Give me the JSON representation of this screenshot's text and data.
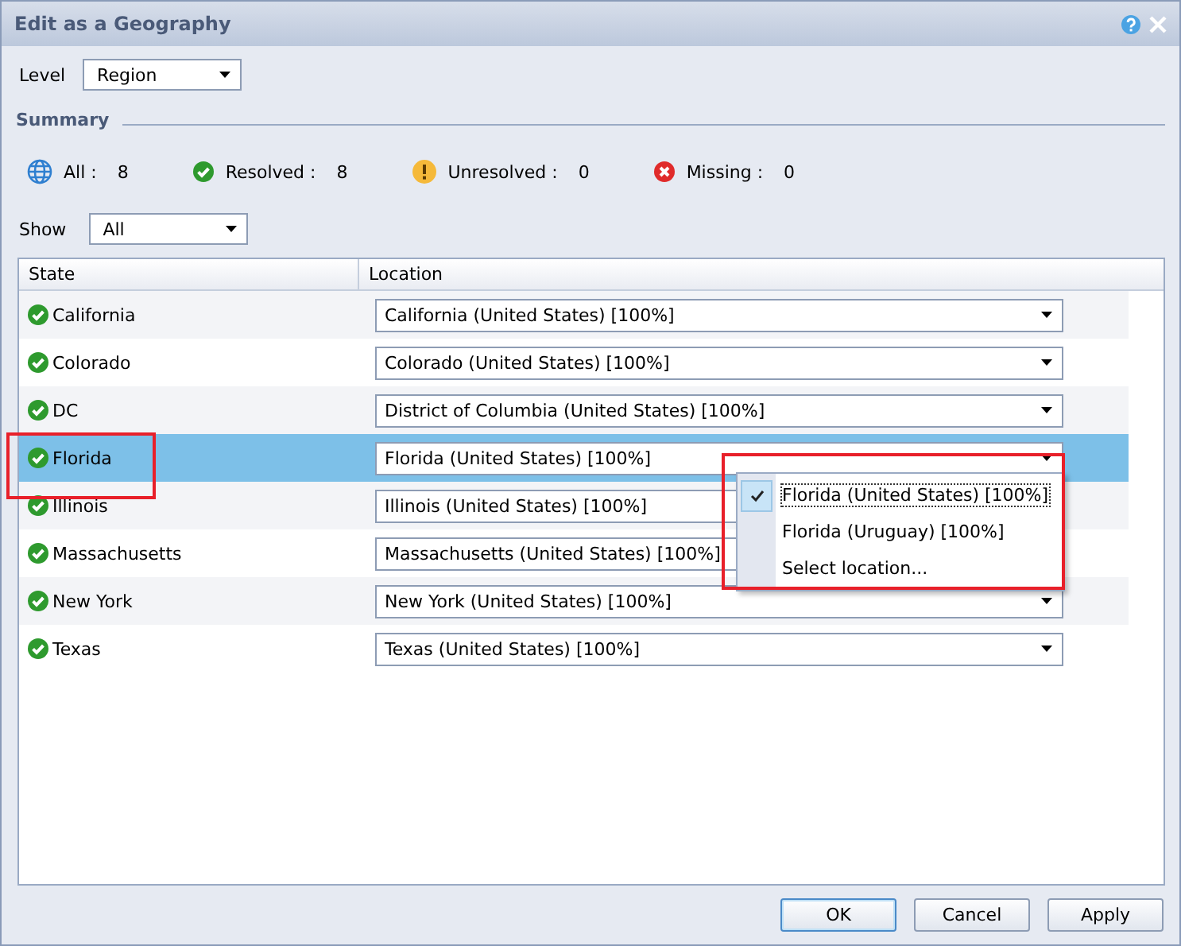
{
  "window": {
    "title": "Edit as a Geography"
  },
  "level": {
    "label": "Level",
    "value": "Region"
  },
  "summary": {
    "title": "Summary",
    "stats": [
      {
        "kind": "all",
        "label": "All :",
        "count": "8"
      },
      {
        "kind": "resolved",
        "label": "Resolved :",
        "count": "8"
      },
      {
        "kind": "unresolved",
        "label": "Unresolved :",
        "count": "0"
      },
      {
        "kind": "missing",
        "label": "Missing :",
        "count": "0"
      }
    ]
  },
  "show": {
    "label": "Show",
    "value": "All"
  },
  "table": {
    "columns": [
      "State",
      "Location"
    ],
    "rows": [
      {
        "state": "California",
        "location": "California (United States) [100%]",
        "selected": false,
        "highlighted": false
      },
      {
        "state": "Colorado",
        "location": "Colorado (United States) [100%]",
        "selected": false,
        "highlighted": false
      },
      {
        "state": "DC",
        "location": "District of Columbia (United States) [100%]",
        "selected": false,
        "highlighted": false
      },
      {
        "state": "Florida",
        "location": "Florida (United States) [100%]",
        "selected": true,
        "highlighted": true
      },
      {
        "state": "Illinois",
        "location": "Illinois (United States) [100%]",
        "selected": false,
        "highlighted": false
      },
      {
        "state": "Massachusetts",
        "location": "Massachusetts (United States) [100%]",
        "selected": false,
        "highlighted": false
      },
      {
        "state": "New York",
        "location": "New York (United States) [100%]",
        "selected": false,
        "highlighted": false
      },
      {
        "state": "Texas",
        "location": "Texas (United States) [100%]",
        "selected": false,
        "highlighted": false
      }
    ]
  },
  "dropdown": {
    "highlighted": true,
    "options": [
      {
        "label": "Florida (United States) [100%]",
        "checked": true
      },
      {
        "label": "Florida (Uruguay) [100%]",
        "checked": false
      },
      {
        "label": "Select location...",
        "checked": false
      }
    ]
  },
  "buttons": [
    "OK",
    "Cancel",
    "Apply"
  ]
}
